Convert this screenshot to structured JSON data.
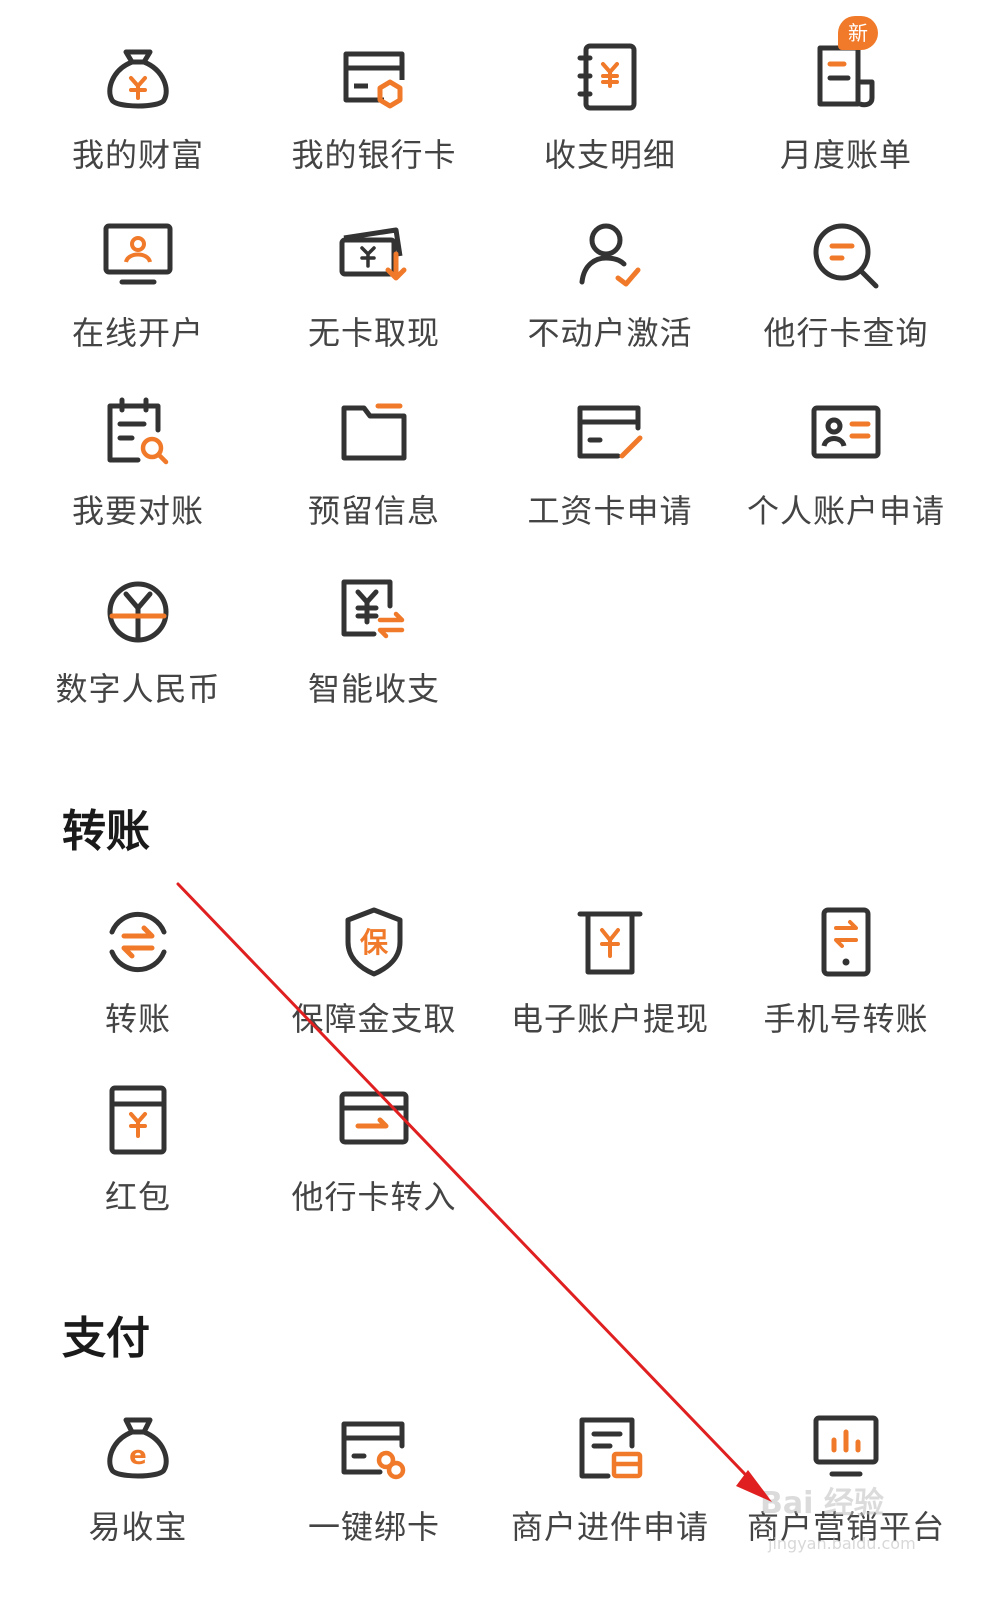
{
  "colors": {
    "accent": "#f07a2a",
    "icon_dark": "#333333",
    "label": "#444444",
    "annotation": "#e02020"
  },
  "grid1": {
    "items": [
      {
        "label": "我的财富",
        "icon": "money-bag-yuan"
      },
      {
        "label": "我的银行卡",
        "icon": "bank-card"
      },
      {
        "label": "收支明细",
        "icon": "ledger-yuan"
      },
      {
        "label": "月度账单",
        "icon": "monthly-bill",
        "badge": "新"
      },
      {
        "label": "在线开户",
        "icon": "monitor-person"
      },
      {
        "label": "无卡取现",
        "icon": "cash-withdraw"
      },
      {
        "label": "不动户激活",
        "icon": "person-check"
      },
      {
        "label": "他行卡查询",
        "icon": "search-magnifier"
      },
      {
        "label": "我要对账",
        "icon": "calendar-search"
      },
      {
        "label": "预留信息",
        "icon": "folder"
      },
      {
        "label": "工资卡申请",
        "icon": "card-pen"
      },
      {
        "label": "个人账户申请",
        "icon": "id-card"
      },
      {
        "label": "数字人民币",
        "icon": "digital-rmb"
      },
      {
        "label": "智能收支",
        "icon": "smart-yuan-exchange"
      }
    ]
  },
  "transfer": {
    "title": "转账",
    "items": [
      {
        "label": "转账",
        "icon": "transfer-arrows"
      },
      {
        "label": "保障金支取",
        "icon": "shield-bao"
      },
      {
        "label": "电子账户提现",
        "icon": "receipt-yuan"
      },
      {
        "label": "手机号转账",
        "icon": "phone-transfer"
      },
      {
        "label": "红包",
        "icon": "red-packet"
      },
      {
        "label": "他行卡转入",
        "icon": "card-transfer-in"
      }
    ]
  },
  "payment": {
    "title": "支付",
    "items": [
      {
        "label": "易收宝",
        "icon": "bag-e"
      },
      {
        "label": "一键绑卡",
        "icon": "card-link"
      },
      {
        "label": "商户进件申请",
        "icon": "merchant-doc"
      },
      {
        "label": "商户营销平台",
        "icon": "bar-chart-monitor"
      }
    ]
  },
  "watermark": {
    "text": "Bai 经验",
    "sub": "jingyan.baidu.com"
  }
}
